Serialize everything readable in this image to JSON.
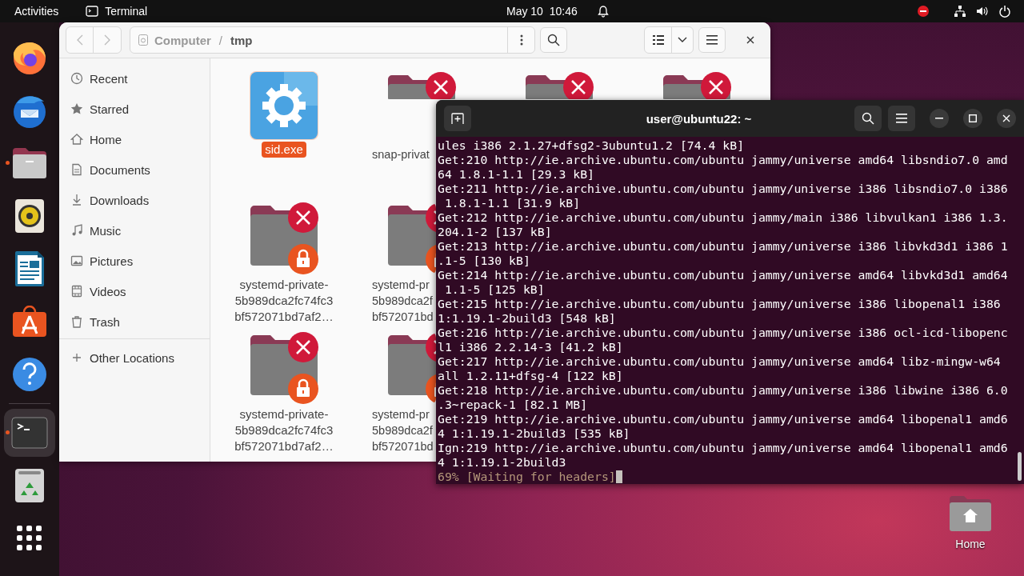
{
  "top_bar": {
    "activities": "Activities",
    "app": "Terminal",
    "clock": "May 10  10:46"
  },
  "dock": [
    {
      "kind": "browser",
      "running": false,
      "active": false
    },
    {
      "kind": "mail",
      "running": false,
      "active": false
    },
    {
      "kind": "files",
      "running": true,
      "active": false
    },
    {
      "kind": "music",
      "running": false,
      "active": false
    },
    {
      "kind": "writer",
      "running": false,
      "active": false
    },
    {
      "kind": "store",
      "running": false,
      "active": false
    },
    {
      "kind": "help",
      "running": false,
      "active": false
    },
    {
      "kind": "separator"
    },
    {
      "kind": "terminal",
      "running": true,
      "active": true
    },
    {
      "kind": "trash",
      "running": false,
      "active": false
    },
    {
      "kind": "apps",
      "running": false,
      "active": false
    }
  ],
  "files_window": {
    "path": [
      {
        "label": "Computer",
        "current": false
      },
      {
        "label": "tmp",
        "current": true
      }
    ],
    "sidebar": [
      {
        "kind": "recent",
        "label": "Recent"
      },
      {
        "kind": "starred",
        "label": "Starred"
      },
      {
        "kind": "home",
        "label": "Home"
      },
      {
        "kind": "documents",
        "label": "Documents"
      },
      {
        "kind": "downloads",
        "label": "Downloads"
      },
      {
        "kind": "music",
        "label": "Music"
      },
      {
        "kind": "pictures",
        "label": "Pictures"
      },
      {
        "kind": "videos",
        "label": "Videos"
      },
      {
        "kind": "trash",
        "label": "Trash"
      },
      {
        "kind": "other",
        "label": "Other Locations"
      }
    ],
    "path_separator": "/",
    "file_rows": [
      {
        "files": [
          {
            "kind": "exe",
            "lines": [
              "sid.exe"
            ],
            "selected": true
          },
          {
            "kind": "locked-folder",
            "lines": [
              "snap-privat"
            ],
            "selected": false
          },
          {
            "kind": "locked-folder",
            "selected": false
          },
          {
            "kind": "locked-folder",
            "selected": false
          }
        ]
      },
      {
        "files": [
          {
            "kind": "locked-folder",
            "lines": [
              "systemd-private-",
              "5b989dca2fc74fc3",
              "bf572071bd7af2…"
            ],
            "selected": false
          },
          {
            "kind": "locked-folder",
            "lines": [
              "systemd-pr",
              "5b989dca2f",
              "bf572071bd"
            ],
            "selected": false
          }
        ]
      },
      {
        "files": [
          {
            "kind": "locked-folder",
            "lines": [
              "systemd-private-",
              "5b989dca2fc74fc3",
              "bf572071bd7af2…"
            ],
            "selected": false
          },
          {
            "kind": "locked-folder",
            "lines": [
              "systemd-pr",
              "5b989dca2f",
              "bf572071bd"
            ],
            "selected": false
          }
        ]
      }
    ]
  },
  "terminal": {
    "title": "user@ubuntu22: ~",
    "lines": [
      "ules i386 2.1.27+dfsg2-3ubuntu1.2 [74.4 kB]",
      "Get:210 http://ie.archive.ubuntu.com/ubuntu jammy/universe amd64 libsndio7.0 amd",
      "64 1.8.1-1.1 [29.3 kB]",
      "Get:211 http://ie.archive.ubuntu.com/ubuntu jammy/universe i386 libsndio7.0 i386",
      " 1.8.1-1.1 [31.9 kB]",
      "Get:212 http://ie.archive.ubuntu.com/ubuntu jammy/main i386 libvulkan1 i386 1.3.",
      "204.1-2 [137 kB]",
      "Get:213 http://ie.archive.ubuntu.com/ubuntu jammy/universe i386 libvkd3d1 i386 1",
      ".1-5 [130 kB]",
      "Get:214 http://ie.archive.ubuntu.com/ubuntu jammy/universe amd64 libvkd3d1 amd64",
      " 1.1-5 [125 kB]",
      "Get:215 http://ie.archive.ubuntu.com/ubuntu jammy/universe i386 libopenal1 i386",
      "1:1.19.1-2build3 [548 kB]",
      "Get:216 http://ie.archive.ubuntu.com/ubuntu jammy/universe i386 ocl-icd-libopenc",
      "l1 i386 2.2.14-3 [41.2 kB]",
      "Get:217 http://ie.archive.ubuntu.com/ubuntu jammy/universe amd64 libz-mingw-w64",
      "all 1.2.11+dfsg-4 [122 kB]",
      "Get:218 http://ie.archive.ubuntu.com/ubuntu jammy/universe i386 libwine i386 6.0",
      ".3~repack-1 [82.1 MB]",
      "Get:219 http://ie.archive.ubuntu.com/ubuntu jammy/universe amd64 libopenal1 amd6",
      "4 1:1.19.1-2build3 [535 kB]",
      "Ign:219 http://ie.archive.ubuntu.com/ubuntu jammy/universe amd64 libopenal1 amd6",
      "4 1:1.19.1-2build3"
    ],
    "status": "69% [Waiting for headers]"
  },
  "desktop_icons": [
    {
      "label": "Home"
    }
  ]
}
